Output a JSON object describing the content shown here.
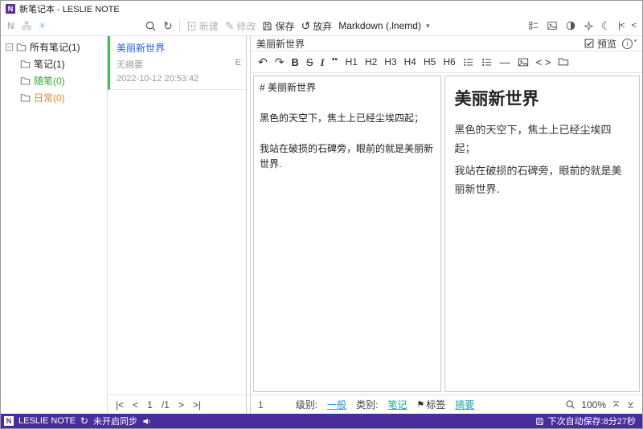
{
  "window": {
    "title": "新笔记本 - LESLIE NOTE",
    "logo_letter": "N"
  },
  "toolbar": {
    "new_label": "新建",
    "modify_label": "修改",
    "save_label": "保存",
    "discard_label": "放弃",
    "format_selector": "Markdown  (.lnemd)"
  },
  "sidebar": {
    "items": [
      {
        "label": "所有笔记(1)"
      },
      {
        "label": "笔记(1)"
      },
      {
        "label": "随笔(0)"
      },
      {
        "label": "日常(0)"
      }
    ]
  },
  "note_list": {
    "items": [
      {
        "title": "美丽新世界",
        "summary": "无摘要",
        "datetime": "2022-10-12 20:53:42",
        "flag": "E"
      }
    ],
    "pagination": {
      "first": "|<",
      "prev": "<",
      "current": "1",
      "total": "/1",
      "next": ">",
      "last": ">|"
    }
  },
  "editor": {
    "note_title": "美丽新世界",
    "preview_toggle_label": "预览",
    "toolbar": {
      "bold": "B",
      "strike": "S",
      "italic": "I",
      "quote": "“",
      "h1": "H1",
      "h2": "H2",
      "h3": "H3",
      "h4": "H4",
      "h5": "H5",
      "h6": "H6",
      "hr": "—",
      "inline_code": "< >"
    },
    "source_lines": [
      "# 美丽新世界",
      "",
      "黑色的天空下，焦土上已经尘埃四起；",
      "",
      "我站在破损的石碑旁，眼前的就是美丽新世界."
    ],
    "preview": {
      "heading": "美丽新世界",
      "paragraphs": [
        "黑色的天空下，焦土上已经尘埃四起；",
        "我站在破损的石碑旁，眼前的就是美丽新世界."
      ]
    },
    "status": {
      "line_number": "1",
      "level_label": "级别:",
      "level_value": "一般",
      "category_label": "类别:",
      "category_value": "笔记",
      "tag_label": "标签",
      "summary_label": "摘要",
      "zoom": "100%"
    }
  },
  "status_bar": {
    "app_name": "LESLIE NOTE",
    "sync_status": "未开启同步",
    "autosave": "下次自动保存:8分27秒"
  },
  "icons": {
    "spinner": "✳",
    "refresh": "↻",
    "edit": "✎",
    "discard": "↺",
    "caret_down": "▾",
    "moon": "☾",
    "collapse_left": "|<",
    "collapse_right": "<",
    "undo": "↶",
    "redo": "↷",
    "flag": "⚑",
    "info": "i",
    "sync": "↻",
    "tree_expander": "−"
  },
  "colors": {
    "accent_purple": "#4a2d9b",
    "note_title_blue": "#2b5cd9",
    "category_green": "#3aa83a",
    "category_orange": "#e5862c",
    "card_green": "#3fbe52",
    "link_blue": "#2e9bd6",
    "link_teal": "#21a7a7"
  }
}
